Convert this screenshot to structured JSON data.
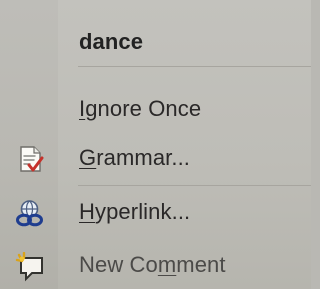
{
  "menu": {
    "suggestion": "dance",
    "items": [
      {
        "label_prefix": "",
        "accelerator": "I",
        "label_suffix": "gnore Once",
        "icon": ""
      },
      {
        "label_prefix": "",
        "accelerator": "G",
        "label_suffix": "rammar...",
        "icon": "grammar-check-icon"
      },
      {
        "label_prefix": "",
        "accelerator": "H",
        "label_suffix": "yperlink...",
        "icon": "hyperlink-icon"
      },
      {
        "label_prefix": "New Co",
        "accelerator": "m",
        "label_suffix": "ment",
        "icon": "new-comment-icon"
      }
    ]
  }
}
